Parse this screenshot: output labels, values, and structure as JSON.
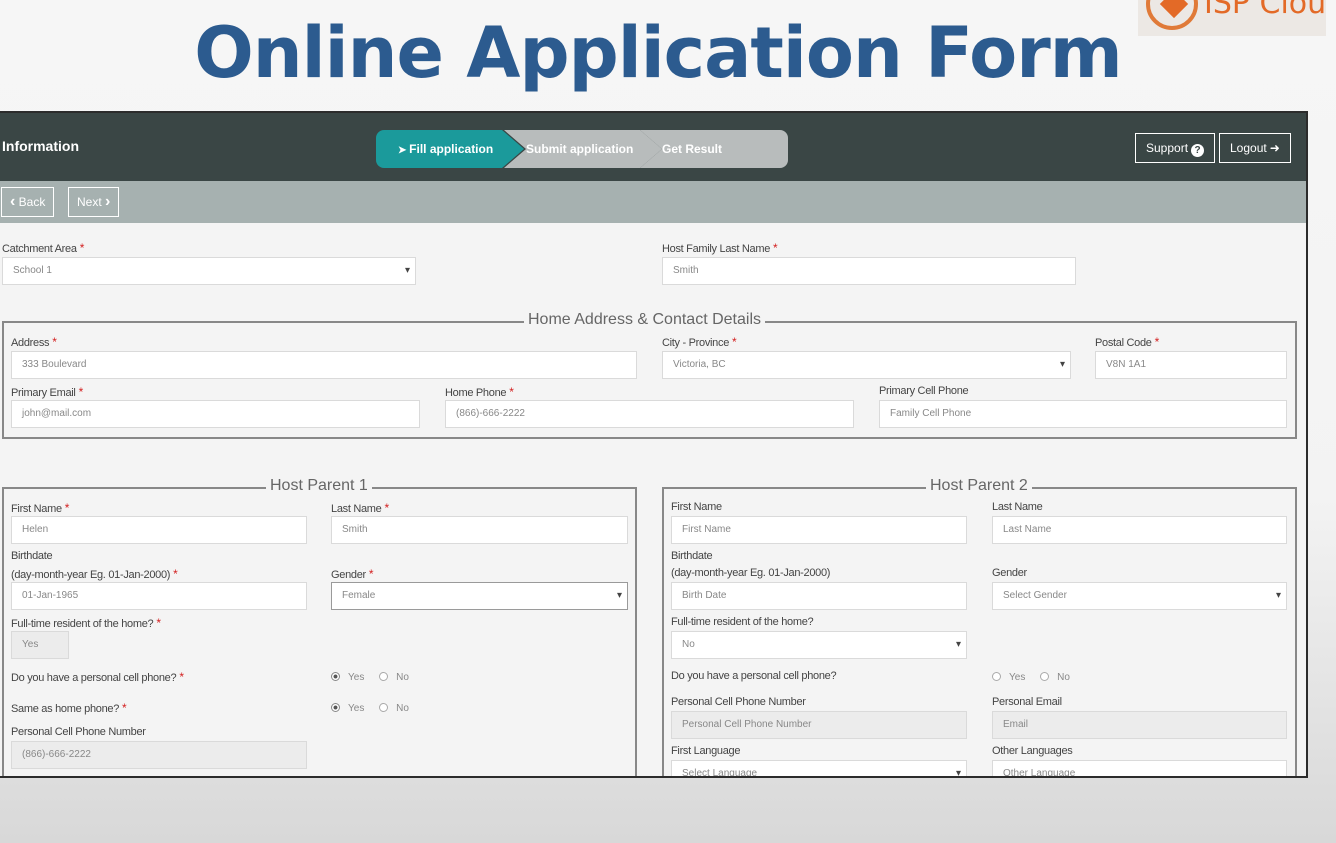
{
  "page": {
    "title": "Online Application Form"
  },
  "logo": {
    "text": "ISP Cloud"
  },
  "header": {
    "section_title": "Information",
    "steps": [
      {
        "label": "Fill application",
        "active": true
      },
      {
        "label": "Submit application",
        "active": false
      },
      {
        "label": "Get Result",
        "active": false
      }
    ],
    "support_label": "Support",
    "logout_label": "Logout"
  },
  "nav": {
    "back_label": "Back",
    "next_label": "Next"
  },
  "form": {
    "catchment_area": {
      "label": "Catchment Area",
      "value": "School 1"
    },
    "host_family_last_name": {
      "label": "Host Family Last Name",
      "value": "Smith"
    },
    "home_address": {
      "legend": "Home Address & Contact Details",
      "address": {
        "label": "Address",
        "value": "333 Boulevard"
      },
      "city_province": {
        "label": "City - Province",
        "value": "Victoria, BC"
      },
      "postal_code": {
        "label": "Postal Code",
        "value": "V8N 1A1"
      },
      "primary_email": {
        "label": "Primary Email",
        "value": "john@mail.com"
      },
      "home_phone": {
        "label": "Home Phone",
        "value": "(866)-666-2222"
      },
      "primary_cell_phone": {
        "label": "Primary Cell Phone",
        "placeholder": "Family Cell Phone"
      }
    },
    "host_parent_1": {
      "legend": "Host Parent 1",
      "first_name": {
        "label": "First Name",
        "value": "Helen"
      },
      "last_name": {
        "label": "Last Name",
        "value": "Smith"
      },
      "birthdate_label_1": "Birthdate",
      "birthdate_label_2": "(day-month-year Eg. 01-Jan-2000)",
      "birthdate_value": "01-Jan-1965",
      "gender": {
        "label": "Gender",
        "value": "Female"
      },
      "full_time": {
        "label": "Full-time resident of the home?",
        "value": "Yes"
      },
      "personal_cell": {
        "label": "Do you have a personal cell phone?",
        "yes": "Yes",
        "no": "No",
        "selected": "Yes"
      },
      "same_as_home": {
        "label": "Same as home phone?",
        "yes": "Yes",
        "no": "No",
        "selected": "Yes"
      },
      "personal_cell_number": {
        "label": "Personal Cell Phone Number",
        "value": "(866)-666-2222"
      }
    },
    "host_parent_2": {
      "legend": "Host Parent 2",
      "first_name": {
        "label": "First Name",
        "placeholder": "First Name"
      },
      "last_name": {
        "label": "Last Name",
        "placeholder": "Last Name"
      },
      "birthdate_label_1": "Birthdate",
      "birthdate_label_2": "(day-month-year Eg. 01-Jan-2000)",
      "birthdate_placeholder": "Birth Date",
      "gender": {
        "label": "Gender",
        "placeholder": "Select Gender"
      },
      "full_time": {
        "label": "Full-time resident of the home?",
        "value": "No"
      },
      "personal_cell": {
        "label": "Do you have a personal cell phone?",
        "yes": "Yes",
        "no": "No",
        "selected": ""
      },
      "personal_cell_number": {
        "label": "Personal Cell Phone Number",
        "placeholder": "Personal Cell Phone Number"
      },
      "personal_email": {
        "label": "Personal Email",
        "placeholder": "Email"
      },
      "first_language": {
        "label": "First Language",
        "placeholder": "Select Language"
      },
      "other_languages": {
        "label": "Other Languages",
        "placeholder": "Other Language"
      }
    }
  }
}
